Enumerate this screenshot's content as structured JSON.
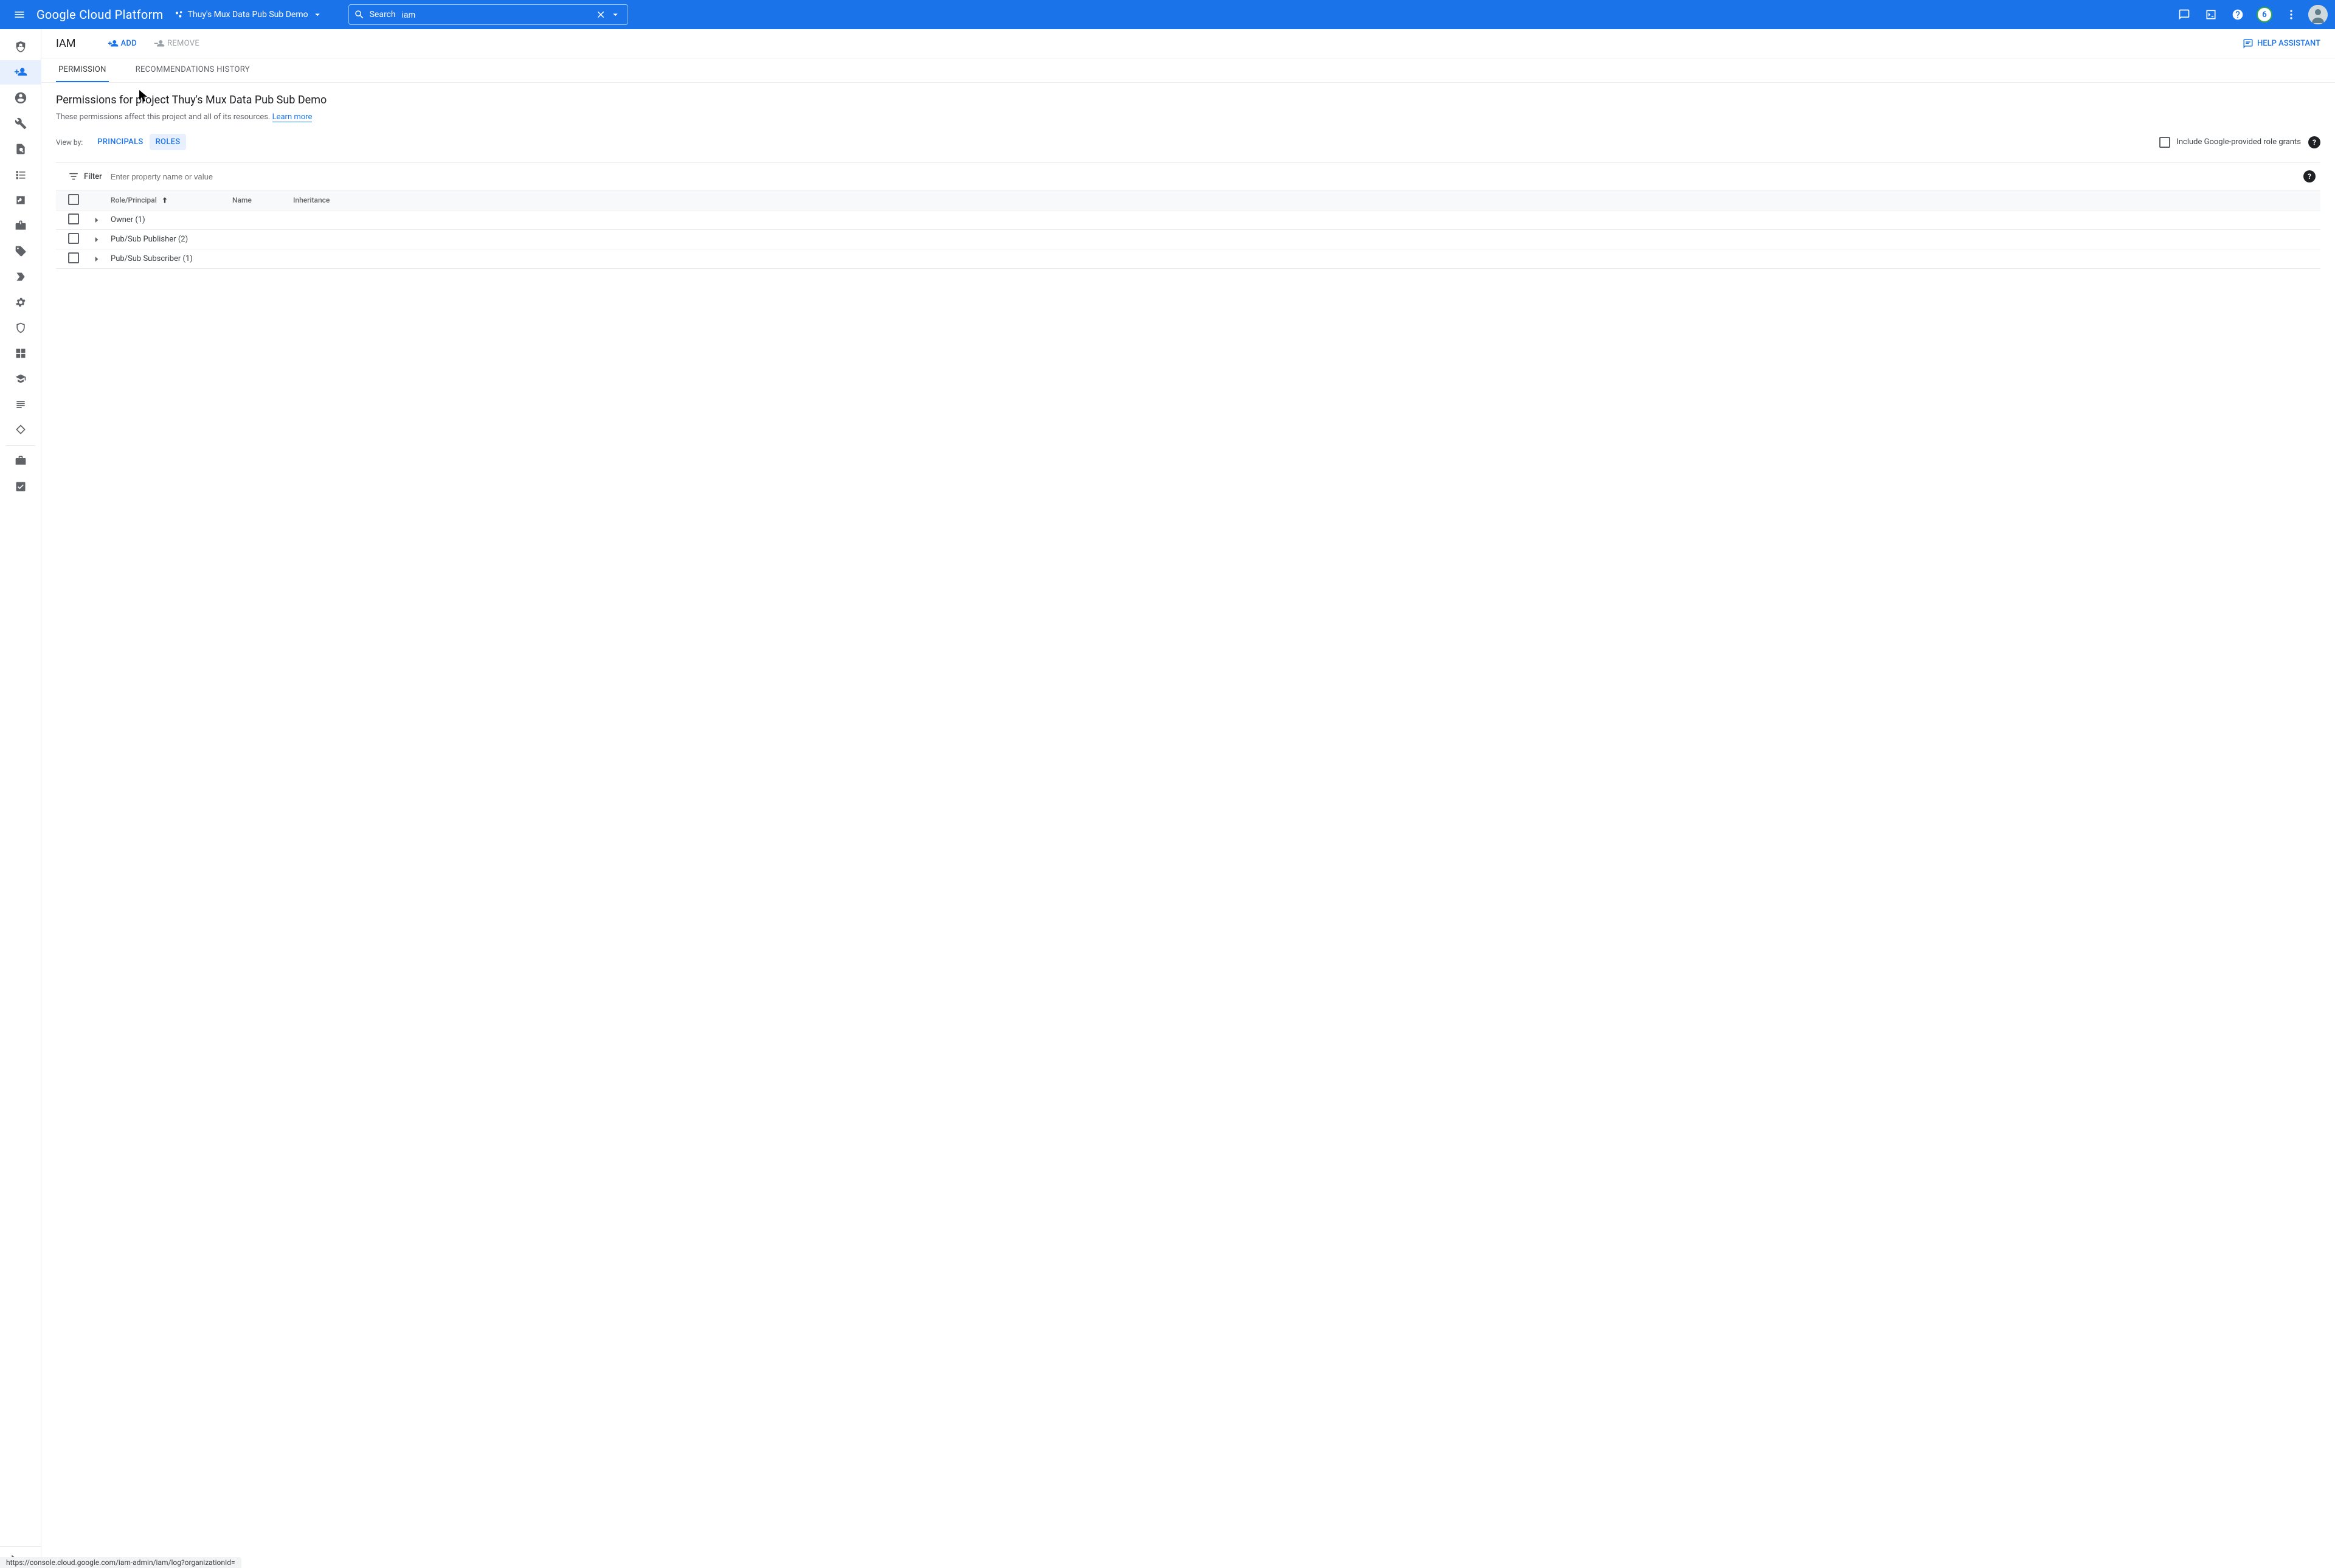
{
  "header": {
    "product": "Google Cloud Platform",
    "project": "Thuy's Mux Data Pub Sub Demo",
    "search_label": "Search",
    "search_value": "iam",
    "notif_count": "6"
  },
  "actionbar": {
    "title": "IAM",
    "add": "ADD",
    "remove": "REMOVE",
    "help": "HELP ASSISTANT"
  },
  "tabs": {
    "permission": "PERMISSION",
    "recs": "RECOMMENDATIONS HISTORY"
  },
  "page": {
    "heading": "Permissions for project Thuy's Mux Data Pub Sub Demo",
    "desc_prefix": "These permissions affect this project and all of its resources. ",
    "learn_more": "Learn more",
    "view_by": "View by:",
    "principals": "PRINCIPALS",
    "roles": "ROLES",
    "include_google": "Include Google-provided role grants"
  },
  "filter": {
    "label": "Filter",
    "placeholder": "Enter property name or value"
  },
  "columns": {
    "role": "Role/Principal",
    "name": "Name",
    "inh": "Inheritance"
  },
  "rows": [
    {
      "label": "Owner (1)"
    },
    {
      "label": "Pub/Sub Publisher (2)"
    },
    {
      "label": "Pub/Sub Subscriber (1)"
    }
  ],
  "status_url": "https://console.cloud.google.com/iam-admin/iam/log?organizationId="
}
